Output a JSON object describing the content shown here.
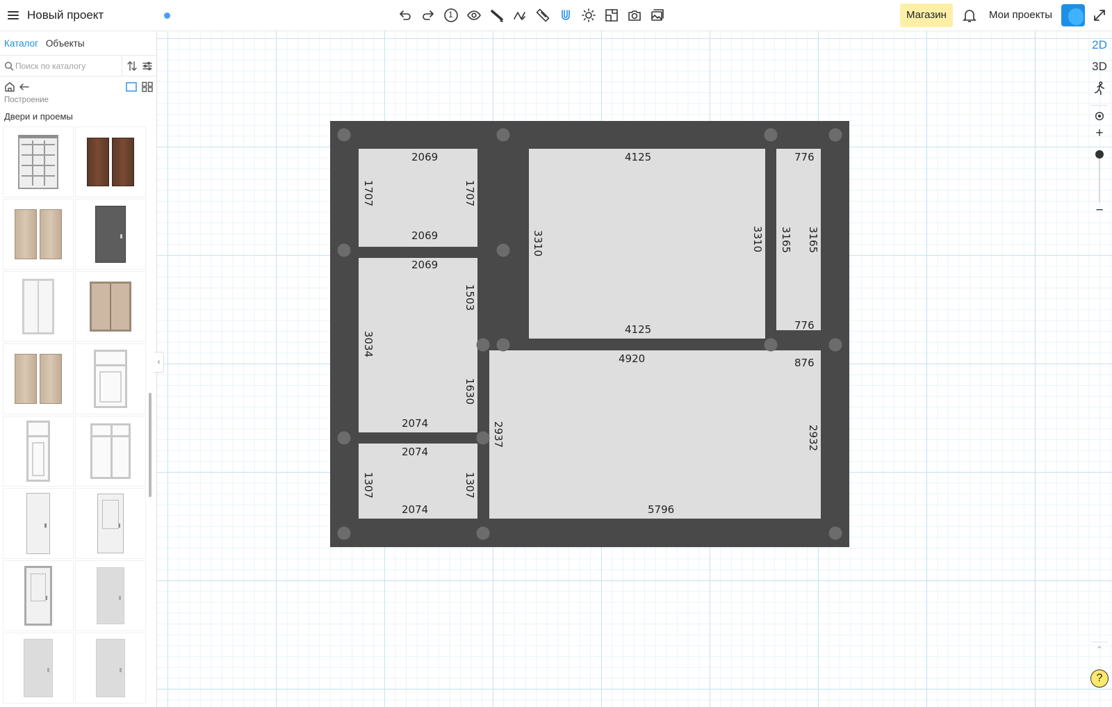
{
  "topbar": {
    "project_title": "Новый проект",
    "tools": [
      "undo-icon",
      "redo-icon",
      "level-1-icon",
      "eye-icon",
      "wall-tool-icon",
      "draw-line-icon",
      "ruler-icon",
      "magnet-icon",
      "sun-icon",
      "floor-plan-icon",
      "camera-icon",
      "gallery-icon"
    ],
    "active_tool": "magnet-icon",
    "level_label": "1",
    "shop_label": "Магазин",
    "my_projects_label": "Мои проекты"
  },
  "sidebar": {
    "tabs": [
      {
        "label": "Каталог",
        "active": true
      },
      {
        "label": "Объекты",
        "active": false
      }
    ],
    "search_placeholder": "Поиск по каталогу",
    "breadcrumb": "Построение",
    "section_title": "Двери и проемы",
    "items": [
      "glass-french-door",
      "wood-double-door",
      "beige-double-door",
      "gray-metal-door",
      "white-glass-balcony-door",
      "beige-sliding-door",
      "beige-double-door-2",
      "white-door-with-transom",
      "white-single-door-transom",
      "white-double-door-transom",
      "white-plain-door",
      "white-panel-door",
      "white-classic-door",
      "white-flush-door",
      "white-flush-door-2",
      "white-flush-door-3"
    ]
  },
  "plan": {
    "dimensions": {
      "r1_top": "2069",
      "r1_bottom": "2069",
      "r1_left": "1707",
      "r1_right": "1707",
      "r2_top": "2069",
      "r2_left": "3034",
      "r2_right_a": "1503",
      "r2_right_b": "1630",
      "r2_bottom": "2074",
      "r3_top": "2074",
      "r3_bottom": "2074",
      "r3_left": "1307",
      "r3_right": "1307",
      "r4_top": "4125",
      "r4_bottom": "4125",
      "r4_left": "3310",
      "r4_right": "3310",
      "r5_top": "776",
      "r5_bottom": "776",
      "r5_left": "3165",
      "r5_right": "3165",
      "r6_top": "4920",
      "r6_top_right": "876",
      "r6_bottom": "5796",
      "r6_left": "2937",
      "r6_right": "2932"
    }
  },
  "rail": {
    "mode_2d": "2D",
    "mode_3d": "3D",
    "active_mode": "2D",
    "zoom_plus": "+",
    "zoom_minus": "−",
    "help": "?"
  }
}
